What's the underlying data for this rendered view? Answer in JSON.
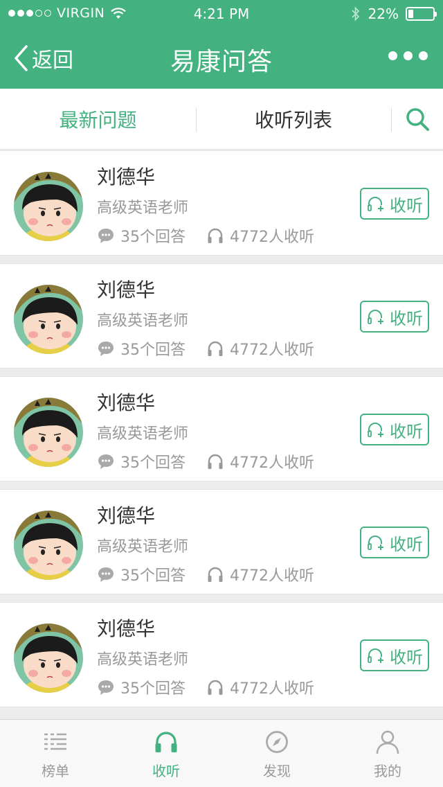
{
  "status_bar": {
    "carrier": "VIRGIN",
    "time": "4:21 PM",
    "battery_text": "22%",
    "battery_level": 0.22,
    "signal_dots_filled": 3,
    "signal_dots_total": 5
  },
  "nav": {
    "back_label": "返回",
    "title": "易康问答",
    "more_icon": "more-dots-icon"
  },
  "tabs": {
    "latest": "最新问题",
    "listen_list": "收听列表",
    "search_icon": "search-icon"
  },
  "colors": {
    "brand": "#44b181",
    "secondary_text": "#999999",
    "primary_text": "#333333"
  },
  "experts": [
    {
      "name": "刘德华",
      "title": "高级英语老师",
      "answers": "35个回答",
      "listeners": "4772人收听",
      "listen_label": "收听"
    },
    {
      "name": "刘德华",
      "title": "高级英语老师",
      "answers": "35个回答",
      "listeners": "4772人收听",
      "listen_label": "收听"
    },
    {
      "name": "刘德华",
      "title": "高级英语老师",
      "answers": "35个回答",
      "listeners": "4772人收听",
      "listen_label": "收听"
    },
    {
      "name": "刘德华",
      "title": "高级英语老师",
      "answers": "35个回答",
      "listeners": "4772人收听",
      "listen_label": "收听"
    },
    {
      "name": "刘德华",
      "title": "高级英语老师",
      "answers": "35个回答",
      "listeners": "4772人收听",
      "listen_label": "收听"
    }
  ],
  "tab_bar": {
    "items": [
      {
        "label": "榜单",
        "icon": "list-ranking-icon"
      },
      {
        "label": "收听",
        "icon": "headphones-icon"
      },
      {
        "label": "发现",
        "icon": "compass-icon"
      },
      {
        "label": "我的",
        "icon": "person-icon"
      }
    ],
    "active_index": 1
  }
}
